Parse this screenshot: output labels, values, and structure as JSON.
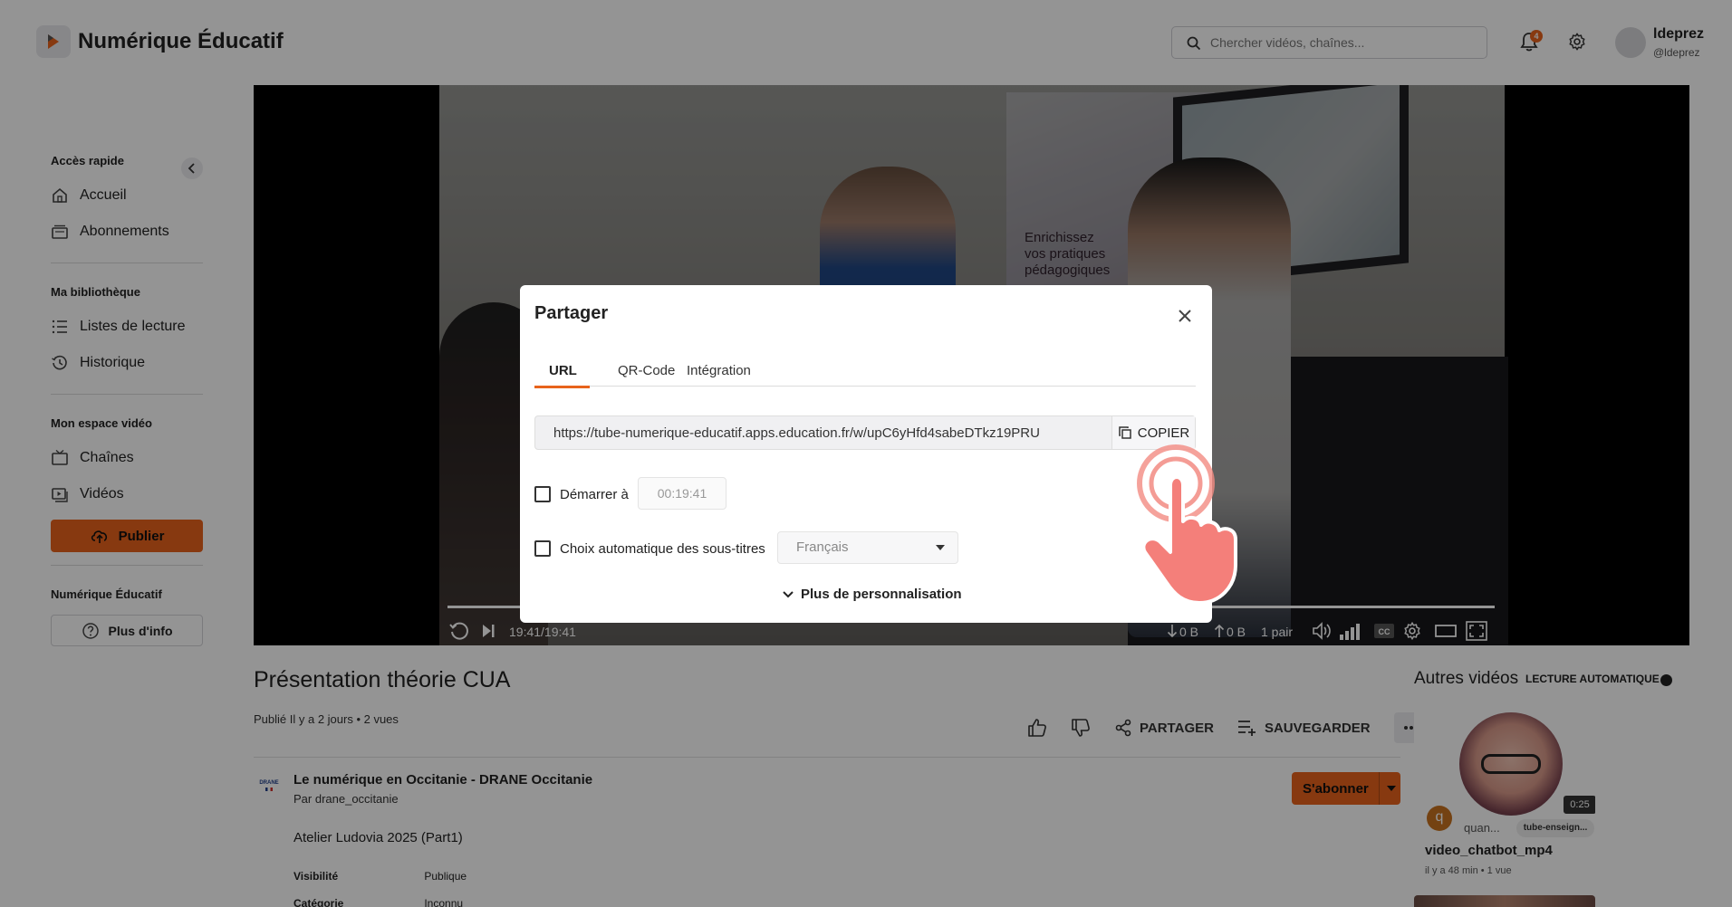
{
  "header": {
    "brand": "Numérique Éducatif",
    "search_placeholder": "Chercher vidéos, chaînes...",
    "notification_count": "4",
    "user_name": "ldeprez",
    "user_handle": "@ldeprez"
  },
  "sidebar": {
    "quick_access_title": "Accès rapide",
    "home": "Accueil",
    "subscriptions": "Abonnements",
    "library_title": "Ma bibliothèque",
    "playlists": "Listes de lecture",
    "history": "Historique",
    "video_space_title": "Mon espace vidéo",
    "channels": "Chaînes",
    "videos": "Vidéos",
    "publish": "Publier",
    "instance_title": "Numérique Éducatif",
    "more_info": "Plus d'info"
  },
  "player": {
    "time": "19:41/19:41",
    "download": "0 B",
    "upload": "0 B",
    "peers": "1 pair",
    "progress": 1.0,
    "booth_text": "Enrichissez\nvos pratiques\npédagogiques"
  },
  "video": {
    "title": "Présentation théorie CUA",
    "meta": "Publié Il y a 2 jours • 2 vues",
    "share": "PARTAGER",
    "save": "SAUVEGARDER",
    "channel_name": "Le numérique en Occitanie - DRANE Occitanie",
    "channel_by": "Par drane_occitanie",
    "channel_logo_text": "DRANE",
    "subscribe": "S'abonner",
    "description": "Atelier Ludovia 2025 (Part1)",
    "visibility_label": "Visibilité",
    "visibility_value": "Publique",
    "category_label": "Catégorie",
    "category_value": "Inconnu"
  },
  "related": {
    "title": "Autres vidéos",
    "autoplay": "LECTURE AUTOMATIQUE",
    "item_title": "video_chatbot_mp4",
    "item_meta": "il y a 48 min • 1 vue",
    "item_duration": "0:25",
    "item_avatar": "q",
    "item_author": "quan...",
    "item_chip": "tube-enseign..."
  },
  "modal": {
    "title": "Partager",
    "tabs": [
      "URL",
      "QR-Code",
      "Intégration"
    ],
    "url": "https://tube-numerique-educatif.apps.education.fr/w/upC6yHfd4sabeDTkz19PRU",
    "copy": "COPIER",
    "start_label": "Démarrer à",
    "start_time": "00:19:41",
    "subtitles_label": "Choix automatique des sous-titres",
    "language": "Français",
    "more_custom": "Plus de personnalisation"
  },
  "colors": {
    "accent": "#e8631c",
    "overlay": "rgba(0,0,0,0.42)"
  }
}
